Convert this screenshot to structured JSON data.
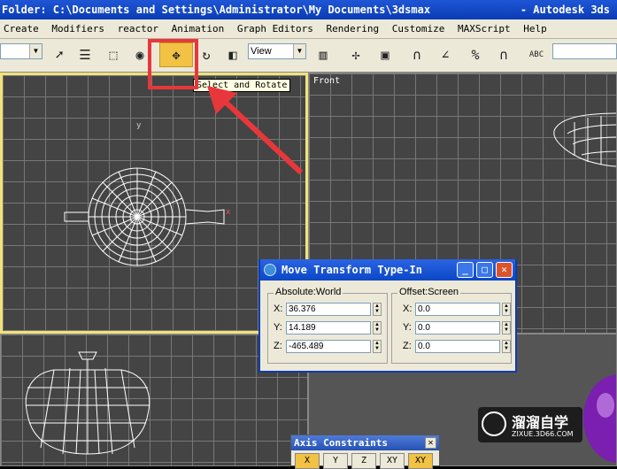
{
  "window": {
    "title": "Folder: C:\\Documents and Settings\\Administrator\\My Documents\\3dsmax",
    "app_name": "- Autodesk 3ds"
  },
  "menu": [
    "Create",
    "Modifiers",
    "reactor",
    "Animation",
    "Graph Editors",
    "Rendering",
    "Customize",
    "MAXScript",
    "Help"
  ],
  "toolbar": {
    "view_dropdown": "View",
    "tooltip": "Select and Rotate"
  },
  "viewports": {
    "front_label": "Front",
    "top_axis_x": "x",
    "top_axis_y": "y"
  },
  "move_dialog": {
    "title": "Move Transform Type-In",
    "absolute_group": "Absolute:World",
    "offset_group": "Offset:Screen",
    "absolute": {
      "x": "36.376",
      "y": "14.189",
      "z": "-465.489"
    },
    "offset": {
      "x": "0.0",
      "y": "0.0",
      "z": "0.0"
    },
    "labels": {
      "x": "X:",
      "y": "Y:",
      "z": "Z:"
    }
  },
  "axis_constraints": {
    "title": "Axis Constraints",
    "buttons": [
      "X",
      "Y",
      "Z",
      "XY",
      "XY"
    ]
  },
  "watermark": {
    "text": "溜溜自学",
    "url": "ZIXUE.3D66.COM"
  },
  "colors": {
    "highlight": "#e8373a",
    "active_viewport": "#f2e27a",
    "titlebar": "#0a3cb4"
  }
}
